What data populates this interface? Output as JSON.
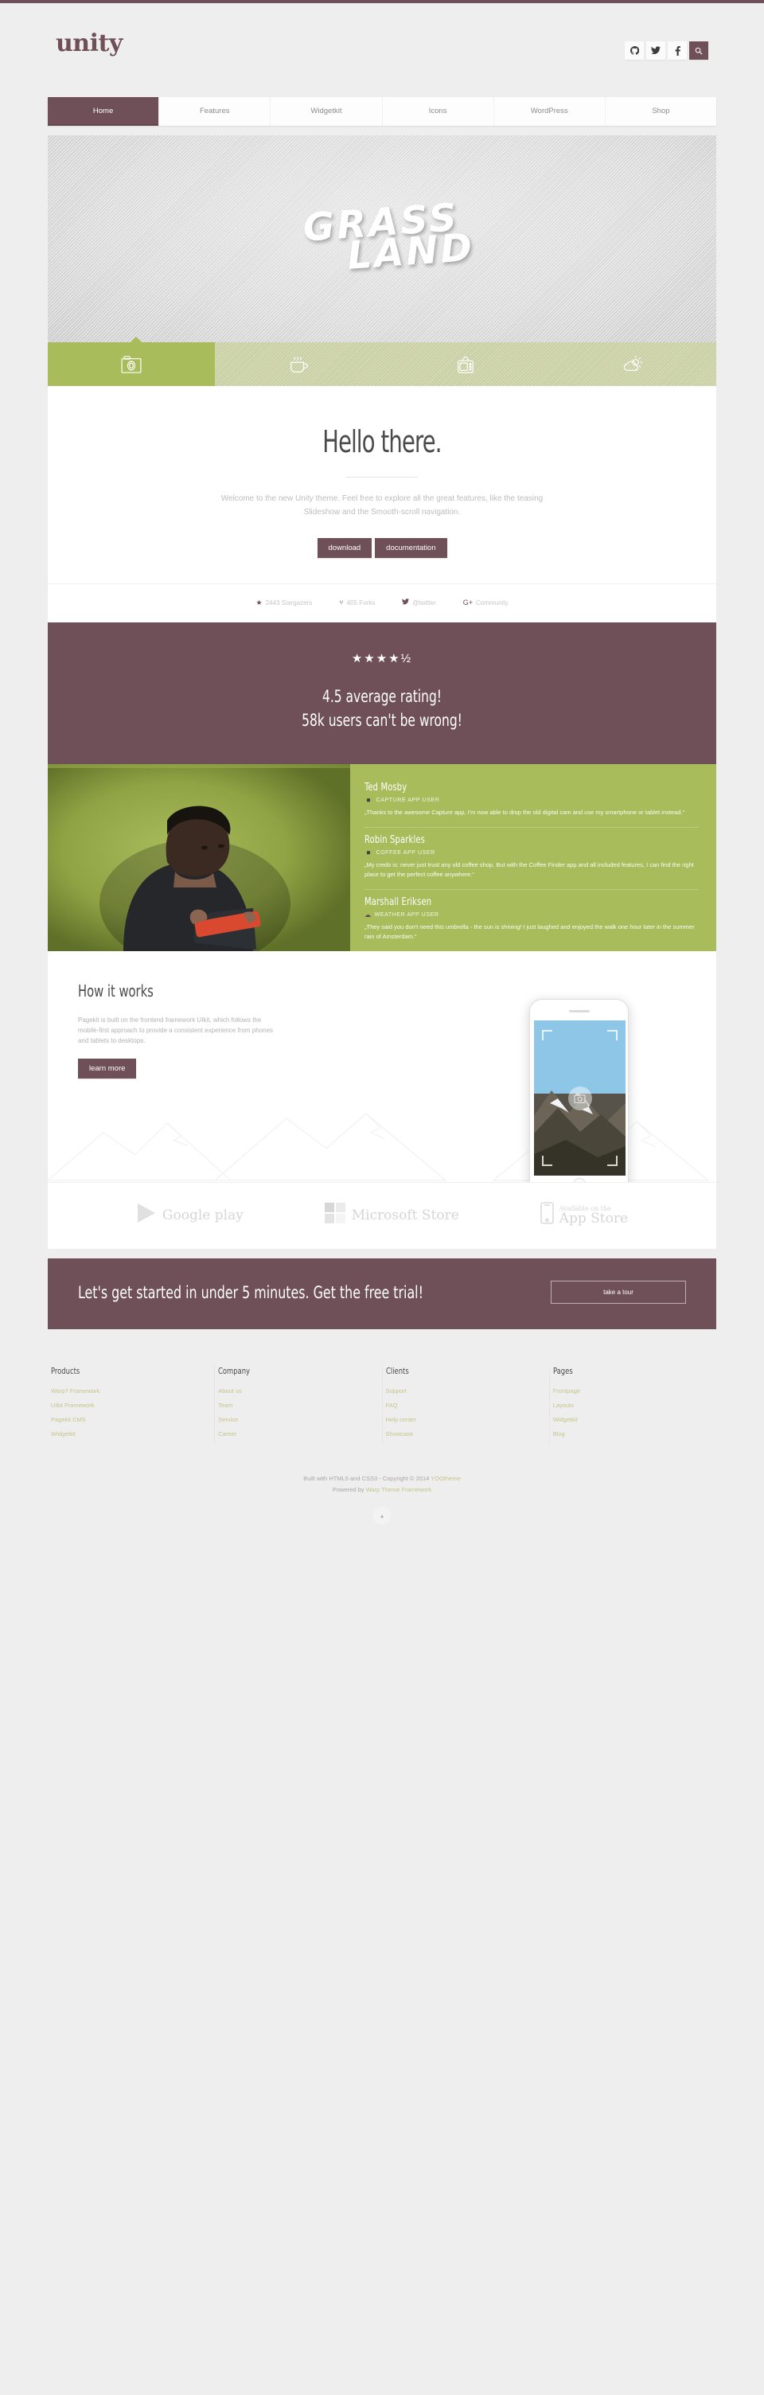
{
  "brand": {
    "logo": "unity",
    "accent": "#6f5059",
    "green": "#a9bc5b"
  },
  "header": {
    "social": [
      {
        "name": "github-icon",
        "label": "GitHub"
      },
      {
        "name": "twitter-icon",
        "label": "Twitter"
      },
      {
        "name": "facebook-icon",
        "label": "Facebook"
      },
      {
        "name": "search-icon",
        "label": "Search"
      }
    ]
  },
  "nav": {
    "items": [
      {
        "label": "Home",
        "active": true
      },
      {
        "label": "Features",
        "active": false
      },
      {
        "label": "Widgetkit",
        "active": false
      },
      {
        "label": "Icons",
        "active": false
      },
      {
        "label": "WordPress",
        "active": false
      },
      {
        "label": "Shop",
        "active": false
      }
    ]
  },
  "hero": {
    "line1": "GRASS",
    "line2": "LAND"
  },
  "icontabs": [
    {
      "name": "camera-icon",
      "active": true
    },
    {
      "name": "coffee-icon",
      "active": false
    },
    {
      "name": "tv-icon",
      "active": false
    },
    {
      "name": "weather-icon",
      "active": false
    }
  ],
  "hello": {
    "title": "Hello there.",
    "text": "Welcome to the new Unity theme. Feel free to explore all the great features, like the teasing Slideshow and the Smooth-scroll navigation.",
    "buttons": [
      {
        "label": "download"
      },
      {
        "label": "documentation"
      }
    ]
  },
  "stats": [
    {
      "icon": "star-icon",
      "glyph": "★",
      "label": "2443 Stargazers"
    },
    {
      "icon": "fork-icon",
      "glyph": "⑂",
      "label": "405 Forks"
    },
    {
      "icon": "twitter-icon",
      "glyph": "✉",
      "label": "@twitter"
    },
    {
      "icon": "google-plus-icon",
      "glyph": "G+",
      "label": "Community"
    }
  ],
  "rating": {
    "stars_value": 4.5,
    "stars_glyphs": "★★★★½",
    "line1": "4.5 average rating!",
    "line2": "58k users can't be wrong!"
  },
  "testimonials": [
    {
      "name": "Ted Mosby",
      "role": "CAPTURE APP USER",
      "role_icon": "camera-icon",
      "quote": "„Thanks to the awesome Capture app, I'm now able to drop the old digital cam and use my smartphone or tablet instead.“"
    },
    {
      "name": "Robin Sparkles",
      "role": "COFFEE APP USER",
      "role_icon": "coffee-icon",
      "quote": "„My credo is: never just trust any old coffee shop. But with the Coffee Finder app and all included features, I can find the right place to get the perfect coffee anywhere.“"
    },
    {
      "name": "Marshall Eriksen",
      "role": "WEATHER APP USER",
      "role_icon": "cloud-icon",
      "quote": "„They said you don't need this umbrella - the sun is shining! I just laughed and enjoyed the walk one hour later in the summer rain of Amsterdam.“"
    }
  ],
  "how": {
    "title": "How it works",
    "text": "Pagekit is built on the frontend framework UIkit, which follows the mobile-first approach to provide a consistent experience from phones and tablets to desktops.",
    "button": "learn more"
  },
  "stores": [
    {
      "name": "google-play-badge",
      "icon": "play-triangle-icon",
      "small": "",
      "text": "Google play"
    },
    {
      "name": "microsoft-store-badge",
      "icon": "windows-squares-icon",
      "small": "",
      "text": "Microsoft Store"
    },
    {
      "name": "app-store-badge",
      "icon": "iphone-icon",
      "small": "Available on the",
      "text": "App Store"
    }
  ],
  "cta": {
    "title": "Let's get started in under 5 minutes. Get the free trial!",
    "button": "take a tour"
  },
  "footer": {
    "columns": [
      {
        "title": "Products",
        "links": [
          "Warp7 Framework",
          "UIkit Framework",
          "Pagekit CMS",
          "Widgetkit"
        ]
      },
      {
        "title": "Company",
        "links": [
          "About us",
          "Team",
          "Service",
          "Career"
        ]
      },
      {
        "title": "Clients",
        "links": [
          "Support",
          "FAQ",
          "Help center",
          "Showcase"
        ]
      },
      {
        "title": "Pages",
        "links": [
          "Frontpage",
          "Layouts",
          "Widgetkit",
          "Blog"
        ]
      }
    ],
    "copyright_prefix": "Built with HTML5 and CSS3 - Copyright © 2014 ",
    "copyright_link": "YOOtheme",
    "powered_prefix": "Powered by ",
    "powered_link": "Warp Theme Framework",
    "totop": "▴"
  }
}
